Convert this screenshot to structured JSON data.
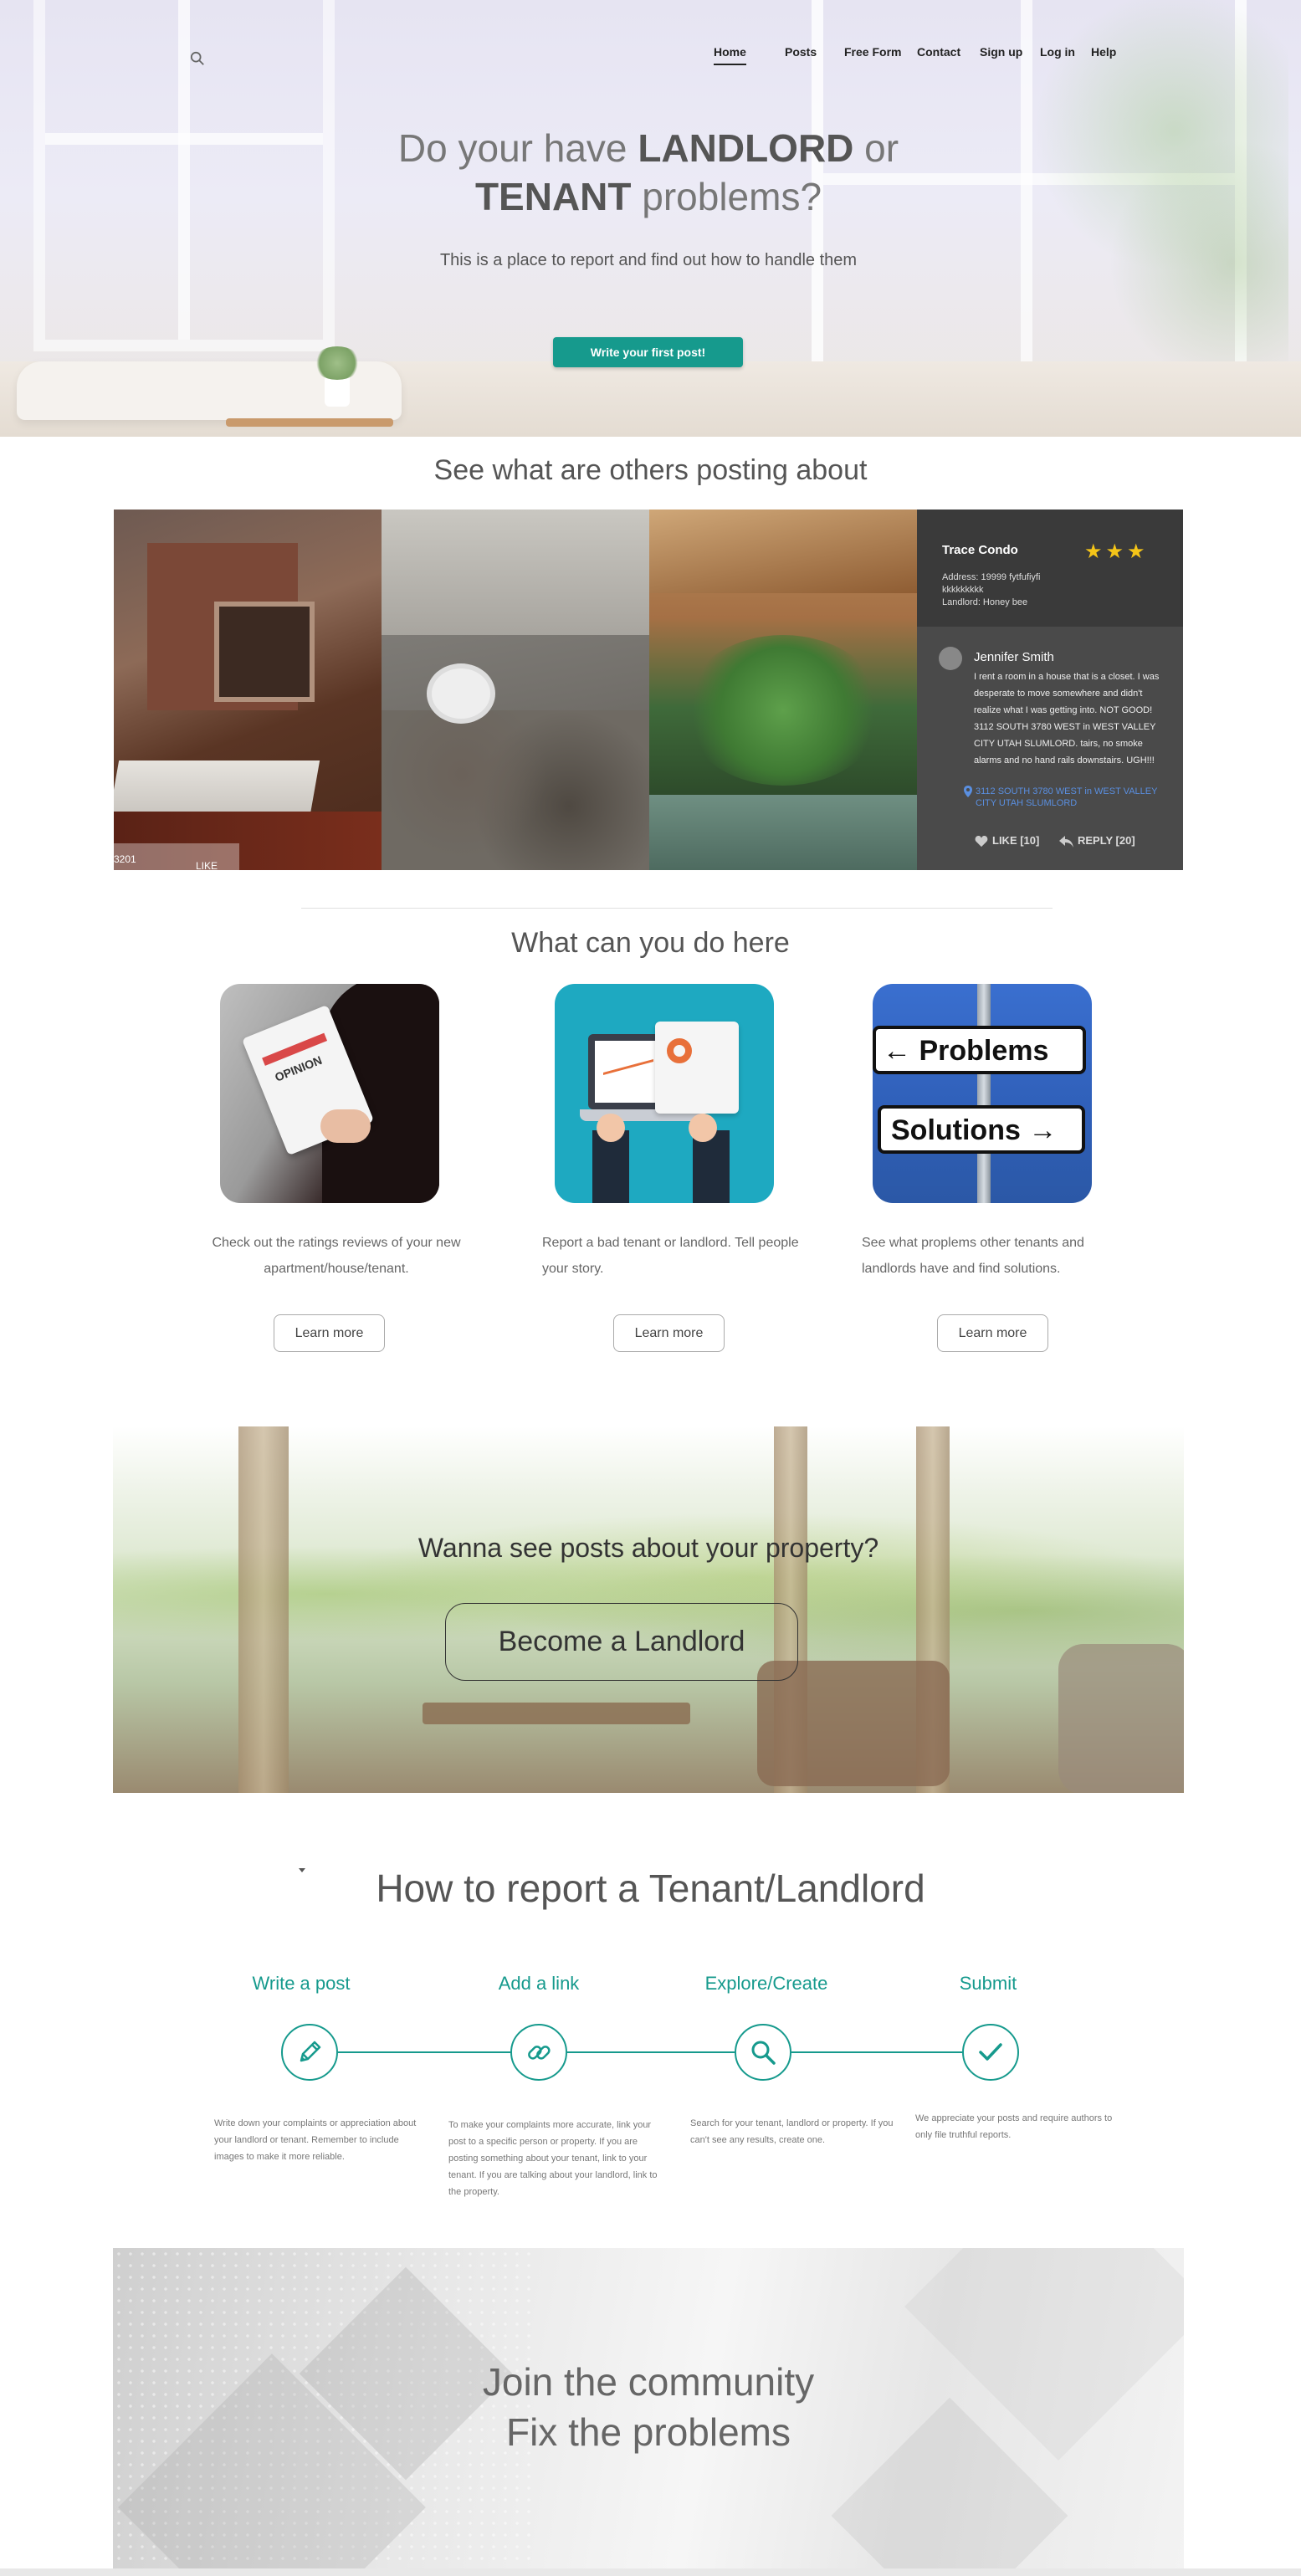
{
  "nav": {
    "items": [
      "Home",
      "Posts",
      "Free Form",
      "Contact",
      "Sign up",
      "Log in",
      "Help"
    ],
    "active": "Home"
  },
  "hero": {
    "title_pre": "Do your have ",
    "title_b1": "LANDLORD",
    "title_mid": " or",
    "title_b2": "TENANT",
    "title_post": " problems?",
    "subtitle": "This is a place to report and find out how to handle them",
    "cta": "Write your first post!"
  },
  "posts": {
    "title": "See what are others posting about",
    "caption_num": "3201",
    "caption_like": "LIKE",
    "review": {
      "property": "Trace Condo",
      "stars": "★★★",
      "rating": 3,
      "address": "Address: 19999 fytfufiyfi kkkkkkkkk",
      "landlord": "Landlord: Honey bee",
      "author": "Jennifer Smith",
      "text": "I rent a room in a house that is a closet. I was desperate to move somewhere and didn't realize what I was getting into. NOT GOOD! 3112 SOUTH 3780 WEST in WEST VALLEY CITY UTAH SLUMLORD. tairs, no smoke alarms and no hand rails downstairs. UGH!!!",
      "location": "3112 SOUTH 3780 WEST in WEST VALLEY CITY UTAH SLUMLORD",
      "like": "LIKE [10]",
      "reply": "REPLY [20]"
    }
  },
  "features": {
    "title": "What can you do here",
    "items": [
      {
        "text": "Check out the ratings reviews of your new apartment/house/tenant.",
        "button": "Learn more",
        "image_text": "OPINION"
      },
      {
        "text": "Report a bad tenant or landlord. Tell people your story.",
        "button": "Learn more"
      },
      {
        "text": "See what proplems other tenants and landlords have and find solutions.",
        "button": "Learn more",
        "sign1": "Problems",
        "sign2": "Solutions"
      }
    ]
  },
  "landlord": {
    "title": "Wanna see posts about your property?",
    "button": "Become a Landlord"
  },
  "howto": {
    "title": "How to report a Tenant/Landlord",
    "steps": [
      {
        "title": "Write a post",
        "icon": "pencil-icon",
        "text": "Write down your complaints or appreciation about your landlord or tenant. Remember to include images to make it more reliable."
      },
      {
        "title": "Add a link",
        "icon": "link-icon",
        "text": "To make your complaints more accurate, link your post to a specific person or property. If you are posting something about your tenant, link to your tenant. If you are  talking about your landlord, link to the property."
      },
      {
        "title": "Explore/Create",
        "icon": "search-icon",
        "text": "Search for your tenant, landlord or property. If you can't see any results, create one."
      },
      {
        "title": "Submit",
        "icon": "check-icon",
        "text": "We appreciate your posts and require authors to only file truthful reports."
      }
    ]
  },
  "join": {
    "line1": "Join the community",
    "line2": "Fix the problems"
  },
  "colors": {
    "accent": "#169a8d",
    "stars": "#f5c518",
    "link": "#5a8fe0"
  }
}
